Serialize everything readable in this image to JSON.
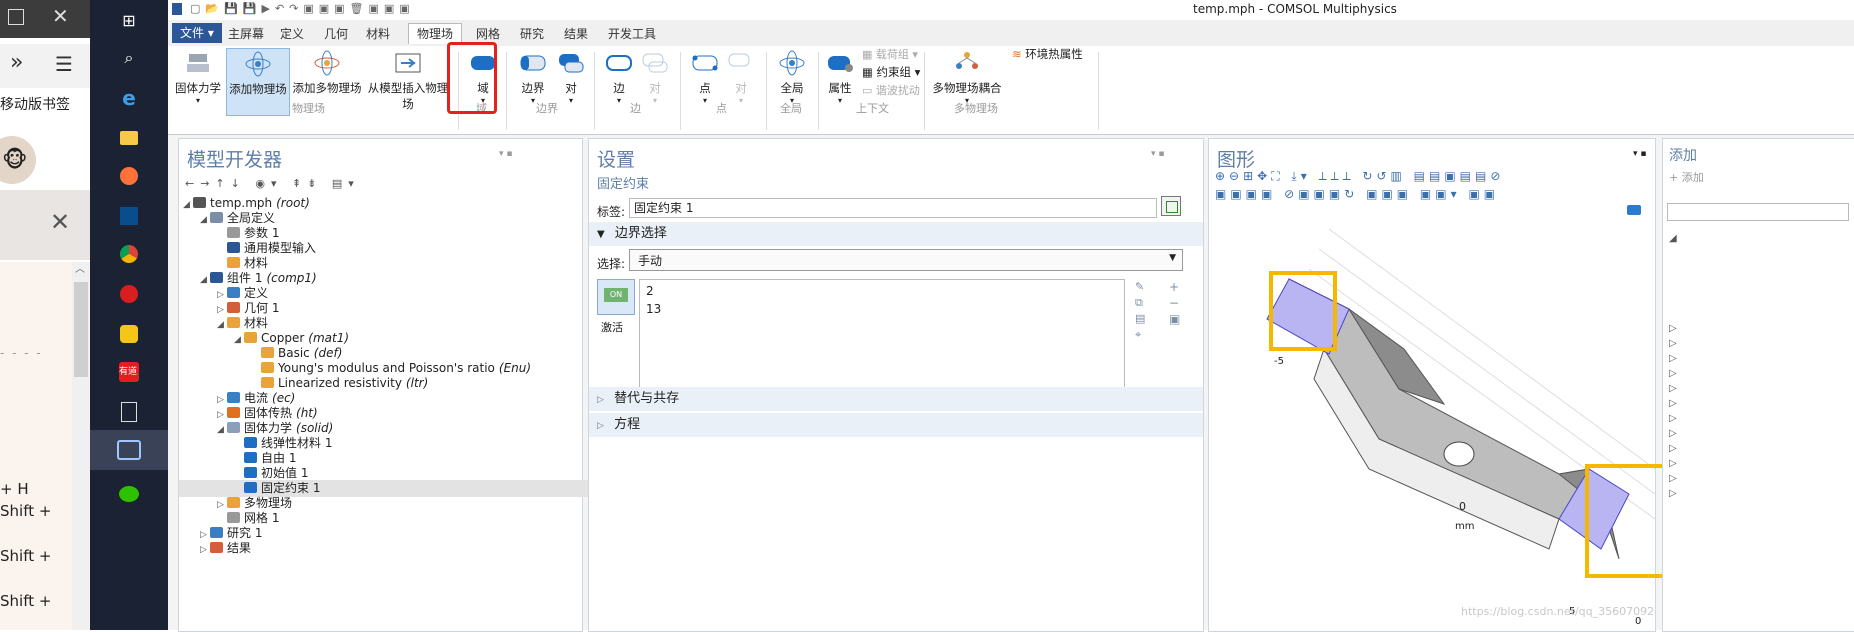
{
  "browser": {
    "bookmark_label": "移动版书签",
    "shortcuts": [
      "+ H",
      "Shift +",
      "Shift +",
      "Shift +"
    ]
  },
  "app": {
    "window_title": "temp.mph - COMSOL Multiphysics",
    "tabs": [
      "文件 ▾",
      "主屏幕",
      "定义",
      "几何",
      "材料",
      "物理场",
      "网格",
      "研究",
      "结果",
      "开发工具"
    ],
    "active_tab": "物理场"
  },
  "ribbon": {
    "solid_mechanics": "固体力学",
    "add_physics": "添加物理场",
    "add_multiphysics": "添加多物理场",
    "insert_from_model": "从模型插入物理场",
    "group_physics": "物理场",
    "domain": "域",
    "group_domain": "域",
    "boundary": "边界",
    "pair_b": "对",
    "group_boundary": "边界",
    "edge": "边",
    "pair_e": "对",
    "group_edge": "边",
    "point": "点",
    "pair_p": "对",
    "group_point": "点",
    "global": "全局",
    "group_global": "全局",
    "attributes": "属性",
    "load_group": "载荷组 ▾",
    "constraint_group": "约束组 ▾",
    "harmonic_perturbation": "谐波扰动",
    "group_context": "上下文",
    "multiphysics_coupling": "多物理场耦合",
    "ambient_thermal": "环境热属性",
    "group_multiphysics": "多物理场"
  },
  "model_builder": {
    "title": "模型开发器",
    "tree": [
      {
        "label": "temp.mph",
        "tag": "(root)"
      },
      {
        "label": "全局定义",
        "tag": ""
      },
      {
        "label": "参数 1",
        "tag": ""
      },
      {
        "label": "通用模型输入",
        "tag": ""
      },
      {
        "label": "材料",
        "tag": ""
      },
      {
        "label": "组件 1",
        "tag": "(comp1)"
      },
      {
        "label": "定义",
        "tag": ""
      },
      {
        "label": "几何 1",
        "tag": ""
      },
      {
        "label": "材料",
        "tag": ""
      },
      {
        "label": "Copper",
        "tag": "(mat1)"
      },
      {
        "label": "Basic",
        "tag": "(def)"
      },
      {
        "label": "Young's modulus and Poisson's ratio",
        "tag": "(Enu)"
      },
      {
        "label": "Linearized resistivity",
        "tag": "(ltr)"
      },
      {
        "label": "电流",
        "tag": "(ec)"
      },
      {
        "label": "固体传热",
        "tag": "(ht)"
      },
      {
        "label": "固体力学",
        "tag": "(solid)"
      },
      {
        "label": "线弹性材料 1",
        "tag": ""
      },
      {
        "label": "自由 1",
        "tag": ""
      },
      {
        "label": "初始值 1",
        "tag": ""
      },
      {
        "label": "固定约束 1",
        "tag": ""
      },
      {
        "label": "多物理场",
        "tag": ""
      },
      {
        "label": "网格 1",
        "tag": ""
      },
      {
        "label": "研究 1",
        "tag": ""
      },
      {
        "label": "结果",
        "tag": ""
      }
    ]
  },
  "settings": {
    "title": "设置",
    "subtitle": "固定约束",
    "label_caption": "标签:",
    "label_value": "固定约束 1",
    "boundary_section": "边界选择",
    "selection_caption": "选择:",
    "selection_value": "手动",
    "active_label": "激活",
    "toggle_text": "ON",
    "boundaries": [
      "2",
      "13"
    ],
    "override_section": "替代与共存",
    "equation_section": "方程"
  },
  "graphics": {
    "title": "图形",
    "axis_zero": "0",
    "axis_unit": "mm",
    "tick_neg": "-5",
    "tick_pos": "5",
    "tick_zero2": "0",
    "watermark": "https://blog.csdn.net/qq_35607092"
  },
  "add_panel": {
    "title": "添加",
    "item": "+ 添加"
  },
  "colors": {
    "accent": "#2b5797",
    "highlight_red": "#e52020",
    "highlight_yellow": "#f5b800",
    "selected_boundary": "#b9b4f2"
  }
}
